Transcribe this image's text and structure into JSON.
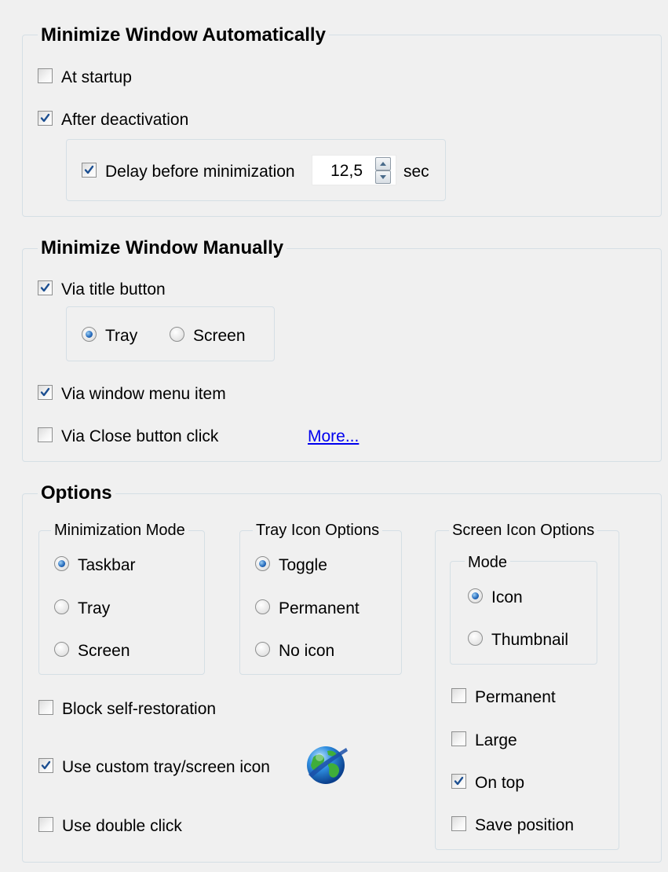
{
  "auto": {
    "title": "Minimize Window Automatically",
    "at_startup": {
      "label": "At startup",
      "checked": false
    },
    "after_deactivation": {
      "label": "After deactivation",
      "checked": true
    },
    "delay": {
      "label": "Delay before minimization",
      "checked": true,
      "value": "12,5",
      "unit": "sec"
    }
  },
  "manual": {
    "title": "Minimize Window Manually",
    "via_title": {
      "label": "Via title button",
      "checked": true
    },
    "tray": {
      "label": "Tray",
      "selected": true
    },
    "screen": {
      "label": "Screen",
      "selected": false
    },
    "via_menu": {
      "label": "Via window menu item",
      "checked": true
    },
    "via_close": {
      "label": "Via Close button click",
      "checked": false
    },
    "more_link": "More..."
  },
  "options": {
    "title": "Options",
    "mode": {
      "title": "Minimization Mode",
      "items": [
        {
          "label": "Taskbar",
          "selected": true
        },
        {
          "label": "Tray",
          "selected": false
        },
        {
          "label": "Screen",
          "selected": false
        }
      ]
    },
    "tray_icon": {
      "title": "Tray Icon Options",
      "items": [
        {
          "label": "Toggle",
          "selected": true
        },
        {
          "label": "Permanent",
          "selected": false
        },
        {
          "label": "No icon",
          "selected": false
        }
      ]
    },
    "screen_icon": {
      "title": "Screen Icon Options",
      "mode_title": "Mode",
      "mode_items": [
        {
          "label": "Icon",
          "selected": true
        },
        {
          "label": "Thumbnail",
          "selected": false
        }
      ],
      "checks": [
        {
          "label": "Permanent",
          "checked": false
        },
        {
          "label": "Large",
          "checked": false
        },
        {
          "label": "On top",
          "checked": true
        },
        {
          "label": "Save position",
          "checked": false
        }
      ]
    },
    "block_self_restoration": {
      "label": "Block self-restoration",
      "checked": false
    },
    "custom_icon": {
      "label": "Use custom tray/screen icon",
      "checked": true,
      "icon": "globe-icon"
    },
    "double_click": {
      "label": "Use double click",
      "checked": false
    }
  }
}
